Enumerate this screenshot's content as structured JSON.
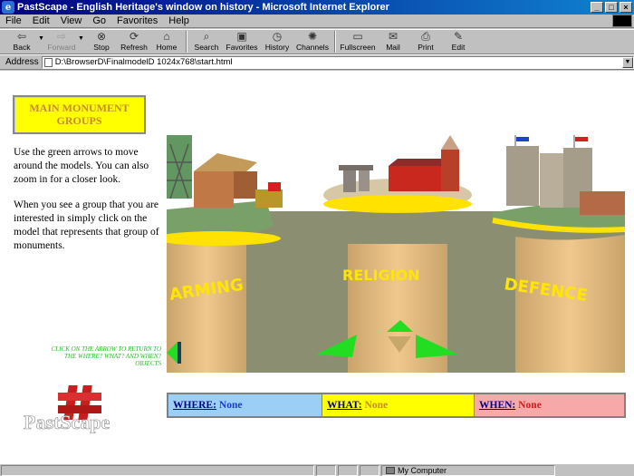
{
  "window": {
    "title": "PastScape - English Heritage's window on history - Microsoft Internet Explorer",
    "controls": [
      "minimize",
      "maximize",
      "close"
    ]
  },
  "menu": [
    "File",
    "Edit",
    "View",
    "Go",
    "Favorites",
    "Help"
  ],
  "toolbar": {
    "back": "Back",
    "forward": "Forward",
    "stop": "Stop",
    "refresh": "Refresh",
    "home": "Home",
    "search": "Search",
    "favorites": "Favorites",
    "history": "History",
    "channels": "Channels",
    "fullscreen": "Fullscreen",
    "mail": "Mail",
    "print": "Print",
    "edit": "Edit"
  },
  "address": {
    "label": "Address",
    "value": "D:\\BrowserD\\FinalmodelD 1024x768\\start.html"
  },
  "page": {
    "main_groups_title": "MAIN MONUMENT GROUPS",
    "intro_1": "Use the green arrows to move around the models. You can also zoom in for a closer look.",
    "intro_2": "When you see a group that you are interested in simply click on the model that represents that group of monuments.",
    "return_hint": "CLICK ON THE ARROW TO RETURN TO THE WHERE? WHAT? AND WHEN? OBJECTS",
    "logo_text": "PastScape",
    "scene_labels": {
      "farming": "ARMING",
      "religion": "RELIGION",
      "defence": "DEFENCE"
    }
  },
  "infobar": {
    "where_label": "WHERE:",
    "where_value": "None",
    "what_label": "WHAT:",
    "what_value": "None",
    "when_label": "WHEN:",
    "when_value": "None"
  },
  "status": {
    "zone": "My Computer"
  },
  "colors": {
    "title_gradient_start": "#000080",
    "yellow_box": "#ffff00",
    "where_bg": "#9ccff5",
    "what_bg": "#ffff00",
    "when_bg": "#f7a8a8",
    "nav_arrows": "#22dd22"
  }
}
